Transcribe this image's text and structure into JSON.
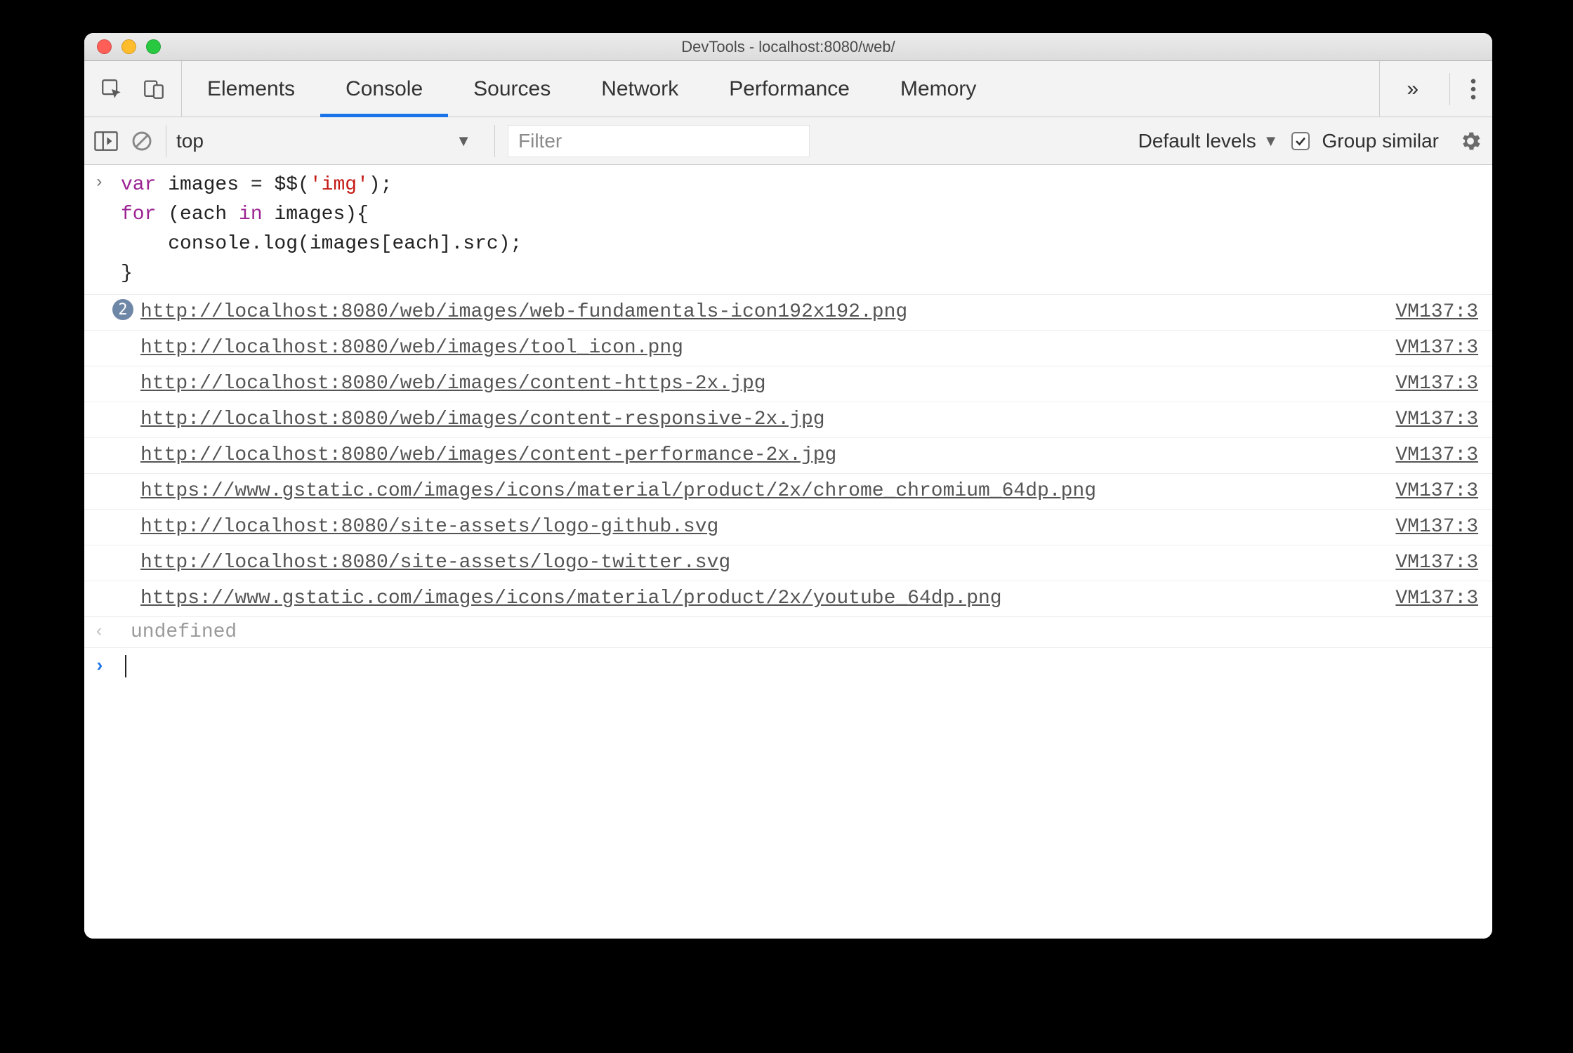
{
  "window": {
    "title": "DevTools - localhost:8080/web/"
  },
  "tabs": {
    "items": [
      "Elements",
      "Console",
      "Sources",
      "Network",
      "Performance",
      "Memory"
    ],
    "activeIndex": 1,
    "overflow_glyph": "»"
  },
  "toolbar": {
    "context": "top",
    "filter_placeholder": "Filter",
    "levels_label": "Default levels",
    "group_similar_label": "Group similar",
    "group_similar_checked": true
  },
  "code": {
    "prompt_glyph": "›",
    "lines": [
      {
        "segments": [
          {
            "t": "var ",
            "c": "kw"
          },
          {
            "t": "images",
            "c": "ident"
          },
          {
            "t": " = $$(",
            "c": "fn"
          },
          {
            "t": "'img'",
            "c": "str"
          },
          {
            "t": ");",
            "c": "fn"
          }
        ]
      },
      {
        "segments": [
          {
            "t": "for ",
            "c": "kw"
          },
          {
            "t": "(each ",
            "c": "ident"
          },
          {
            "t": "in ",
            "c": "kw"
          },
          {
            "t": "images){",
            "c": "ident"
          }
        ]
      },
      {
        "segments": [
          {
            "t": "    console.log(images[each].src);",
            "c": "fn"
          }
        ]
      },
      {
        "segments": [
          {
            "t": "}",
            "c": "fn"
          }
        ]
      }
    ]
  },
  "logs": [
    {
      "badge": "2",
      "url": "http://localhost:8080/web/images/web-fundamentals-icon192x192.png",
      "src": "VM137:3"
    },
    {
      "url": "http://localhost:8080/web/images/tool_icon.png",
      "src": "VM137:3"
    },
    {
      "url": "http://localhost:8080/web/images/content-https-2x.jpg",
      "src": "VM137:3"
    },
    {
      "url": "http://localhost:8080/web/images/content-responsive-2x.jpg",
      "src": "VM137:3"
    },
    {
      "url": "http://localhost:8080/web/images/content-performance-2x.jpg",
      "src": "VM137:3"
    },
    {
      "url": "https://www.gstatic.com/images/icons/material/product/2x/chrome_chromium_64dp.png",
      "src": "VM137:3"
    },
    {
      "url": "http://localhost:8080/site-assets/logo-github.svg",
      "src": "VM137:3"
    },
    {
      "url": "http://localhost:8080/site-assets/logo-twitter.svg",
      "src": "VM137:3"
    },
    {
      "url": "https://www.gstatic.com/images/icons/material/product/2x/youtube_64dp.png",
      "src": "VM137:3"
    }
  ],
  "result": {
    "glyph": "‹",
    "text": "undefined"
  },
  "prompt": {
    "glyph": "›"
  }
}
